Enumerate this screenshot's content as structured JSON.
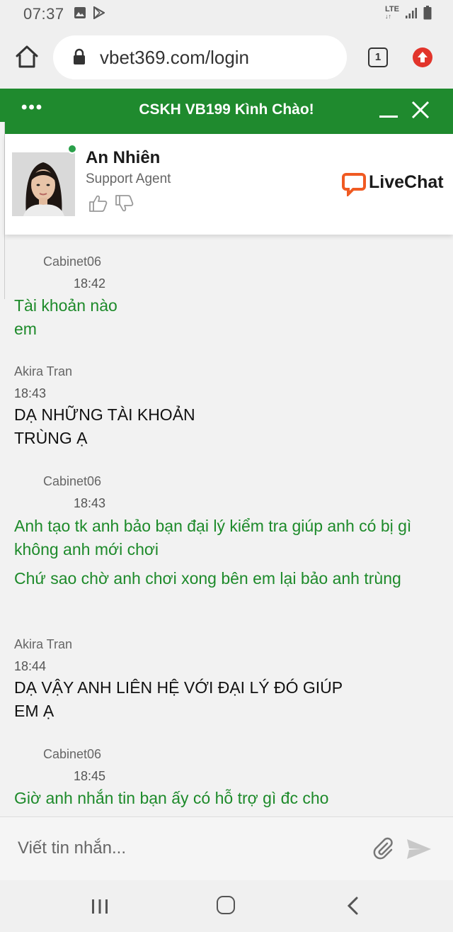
{
  "status_bar": {
    "time": "07:37",
    "network": "LTE",
    "icons": [
      "image-icon",
      "play-store-icon",
      "signal-icon",
      "battery-icon"
    ]
  },
  "browser": {
    "url": "vbet369.com/login",
    "tab_count": "1"
  },
  "chat": {
    "header_title": "CSKH VB199 Kình Chào!",
    "agent": {
      "name": "An Nhiên",
      "role": "Support Agent",
      "status": "online"
    },
    "brand": "LiveChat",
    "brand_color": "#f05a22",
    "header_color": "#1f8a2e",
    "messages": [
      {
        "author": "Cabinet06",
        "time": "18:42",
        "text": "Tài khoản nào em",
        "side": "agent"
      },
      {
        "author": "Akira Tran",
        "time": "18:43",
        "text": "DẠ NHỮNG TÀI KHOẢN TRÙNG Ạ",
        "side": "user"
      },
      {
        "author": "Cabinet06",
        "time": "18:43",
        "text": "Anh tạo tk anh bảo bạn đại lý kiểm tra giúp anh có bị gì không anh mới chơi",
        "text2": "Chứ sao chờ anh chơi xong bên em lại bảo anh trùng",
        "side": "agent"
      },
      {
        "author": "Akira Tran",
        "time": "18:44",
        "text": "DẠ VẬY ANH LIÊN HỆ VỚI ĐẠI LÝ ĐÓ GIÚP EM Ạ",
        "side": "user"
      },
      {
        "author": "Cabinet06",
        "time": "18:45",
        "text": "Giờ anh nhắn tin bạn ấy có hỗ trợ gì đc cho",
        "side": "agent"
      }
    ],
    "composer_placeholder": "Viết tin nhắn..."
  }
}
